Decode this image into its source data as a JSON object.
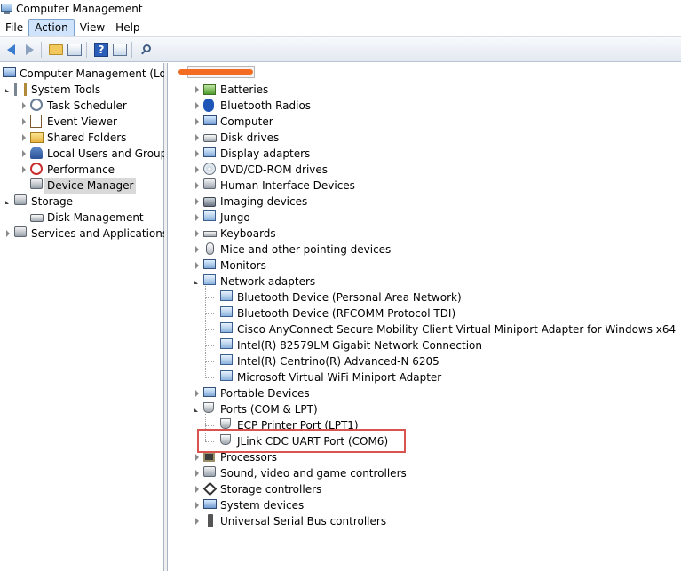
{
  "window": {
    "title": "Computer Management"
  },
  "menu": [
    "File",
    "Action",
    "View",
    "Help"
  ],
  "left_tree": {
    "root": "Computer Management (Local",
    "items": [
      {
        "label": "System Tools",
        "level": 1,
        "expand": "open",
        "icon": "tools-icon"
      },
      {
        "label": "Task Scheduler",
        "level": 2,
        "expand": "closed",
        "icon": "clock-icon"
      },
      {
        "label": "Event Viewer",
        "level": 2,
        "expand": "closed",
        "icon": "event-viewer-icon"
      },
      {
        "label": "Shared Folders",
        "level": 2,
        "expand": "closed",
        "icon": "shared-folder-icon"
      },
      {
        "label": "Local Users and Groups",
        "level": 2,
        "expand": "closed",
        "icon": "users-icon"
      },
      {
        "label": "Performance",
        "level": 2,
        "expand": "closed",
        "icon": "performance-icon"
      },
      {
        "label": "Device Manager",
        "level": 2,
        "expand": "none",
        "icon": "device-manager-icon",
        "selected": true
      },
      {
        "label": "Storage",
        "level": 1,
        "expand": "open",
        "icon": "storage-icon"
      },
      {
        "label": "Disk Management",
        "level": 2,
        "expand": "none",
        "icon": "disk-management-icon"
      },
      {
        "label": "Services and Applications",
        "level": 1,
        "expand": "closed",
        "icon": "services-icon"
      }
    ]
  },
  "device_tree": {
    "categories": [
      {
        "label": "Batteries",
        "icon": "battery-icon"
      },
      {
        "label": "Bluetooth Radios",
        "icon": "bluetooth-icon"
      },
      {
        "label": "Computer",
        "icon": "computer-icon"
      },
      {
        "label": "Disk drives",
        "icon": "disk-drive-icon"
      },
      {
        "label": "Display adapters",
        "icon": "display-adapter-icon"
      },
      {
        "label": "DVD/CD-ROM drives",
        "icon": "cd-drive-icon"
      },
      {
        "label": "Human Interface Devices",
        "icon": "hid-icon"
      },
      {
        "label": "Imaging devices",
        "icon": "camera-icon"
      },
      {
        "label": "Jungo",
        "icon": "jungo-icon"
      },
      {
        "label": "Keyboards",
        "icon": "keyboard-icon"
      },
      {
        "label": "Mice and other pointing devices",
        "icon": "mouse-icon"
      },
      {
        "label": "Monitors",
        "icon": "monitor-icon"
      },
      {
        "label": "Network adapters",
        "icon": "network-adapter-icon",
        "open": true,
        "children": [
          "Bluetooth Device (Personal Area Network)",
          "Bluetooth Device (RFCOMM Protocol TDI)",
          "Cisco AnyConnect Secure Mobility Client Virtual Miniport Adapter for Windows x64",
          "Intel(R) 82579LM Gigabit Network Connection",
          "Intel(R) Centrino(R) Advanced-N 6205",
          "Microsoft Virtual WiFi Miniport Adapter"
        ]
      },
      {
        "label": "Portable Devices",
        "icon": "portable-device-icon"
      },
      {
        "label": "Ports (COM & LPT)",
        "icon": "port-icon",
        "open": true,
        "children": [
          "ECP Printer Port (LPT1)",
          "JLink CDC UART Port (COM6)"
        ]
      },
      {
        "label": "Processors",
        "icon": "processor-icon"
      },
      {
        "label": "Sound, video and game controllers",
        "icon": "sound-icon"
      },
      {
        "label": "Storage controllers",
        "icon": "storage-controller-icon"
      },
      {
        "label": "System devices",
        "icon": "system-device-icon"
      },
      {
        "label": "Universal Serial Bus controllers",
        "icon": "usb-icon"
      }
    ]
  },
  "highlight": {
    "target": "JLink CDC UART Port (COM6)",
    "color": "#d9534f"
  }
}
